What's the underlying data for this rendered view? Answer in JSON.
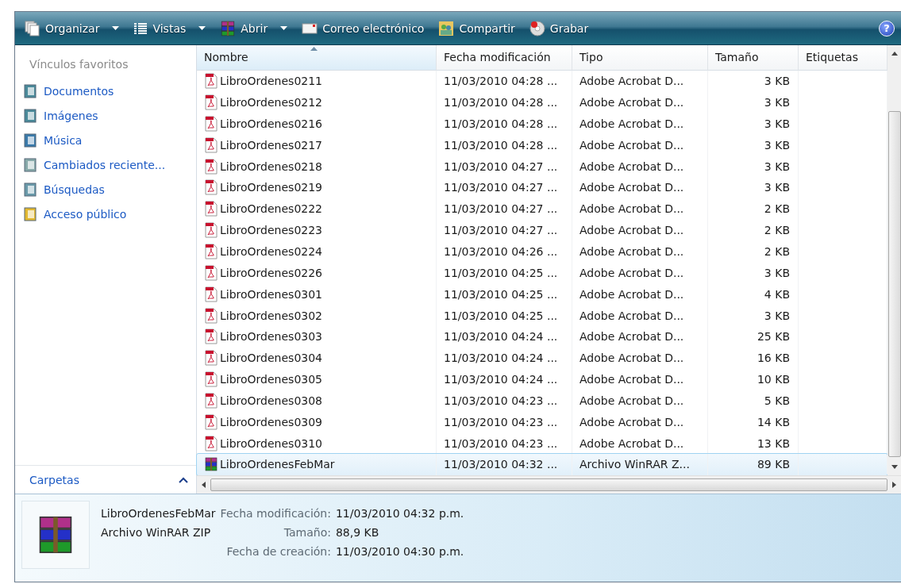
{
  "toolbar": [
    {
      "label": "Organizar",
      "dropdown": true
    },
    {
      "label": "Vistas",
      "dropdown": true
    },
    {
      "label": "Abrir",
      "dropdown": true
    },
    {
      "label": "Correo electrónico",
      "dropdown": false
    },
    {
      "label": "Compartir",
      "dropdown": false
    },
    {
      "label": "Grabar",
      "dropdown": false
    }
  ],
  "help": "?",
  "sidebar": {
    "title": "Vínculos favoritos",
    "items": [
      {
        "label": "Documentos"
      },
      {
        "label": "Imágenes"
      },
      {
        "label": "Música"
      },
      {
        "label": "Cambiados reciente..."
      },
      {
        "label": "Búsquedas"
      },
      {
        "label": "Acceso público"
      }
    ],
    "folders": "Carpetas"
  },
  "table": {
    "columns": [
      "Nombre",
      "Fecha modificación",
      "Tipo",
      "Tamaño",
      "Etiquetas"
    ],
    "rows": [
      {
        "name": "LibroOrdenes0211",
        "date": "11/03/2010 04:28 ...",
        "type": "Adobe Acrobat D...",
        "size": "3 KB",
        "kind": "pdf",
        "selected": false
      },
      {
        "name": "LibroOrdenes0212",
        "date": "11/03/2010 04:28 ...",
        "type": "Adobe Acrobat D...",
        "size": "3 KB",
        "kind": "pdf",
        "selected": false
      },
      {
        "name": "LibroOrdenes0216",
        "date": "11/03/2010 04:28 ...",
        "type": "Adobe Acrobat D...",
        "size": "3 KB",
        "kind": "pdf",
        "selected": false
      },
      {
        "name": "LibroOrdenes0217",
        "date": "11/03/2010 04:28 ...",
        "type": "Adobe Acrobat D...",
        "size": "3 KB",
        "kind": "pdf",
        "selected": false
      },
      {
        "name": "LibroOrdenes0218",
        "date": "11/03/2010 04:27 ...",
        "type": "Adobe Acrobat D...",
        "size": "3 KB",
        "kind": "pdf",
        "selected": false
      },
      {
        "name": "LibroOrdenes0219",
        "date": "11/03/2010 04:27 ...",
        "type": "Adobe Acrobat D...",
        "size": "3 KB",
        "kind": "pdf",
        "selected": false
      },
      {
        "name": "LibroOrdenes0222",
        "date": "11/03/2010 04:27 ...",
        "type": "Adobe Acrobat D...",
        "size": "2 KB",
        "kind": "pdf",
        "selected": false
      },
      {
        "name": "LibroOrdenes0223",
        "date": "11/03/2010 04:27 ...",
        "type": "Adobe Acrobat D...",
        "size": "2 KB",
        "kind": "pdf",
        "selected": false
      },
      {
        "name": "LibroOrdenes0224",
        "date": "11/03/2010 04:26 ...",
        "type": "Adobe Acrobat D...",
        "size": "2 KB",
        "kind": "pdf",
        "selected": false
      },
      {
        "name": "LibroOrdenes0226",
        "date": "11/03/2010 04:25 ...",
        "type": "Adobe Acrobat D...",
        "size": "3 KB",
        "kind": "pdf",
        "selected": false
      },
      {
        "name": "LibroOrdenes0301",
        "date": "11/03/2010 04:25 ...",
        "type": "Adobe Acrobat D...",
        "size": "4 KB",
        "kind": "pdf",
        "selected": false
      },
      {
        "name": "LibroOrdenes0302",
        "date": "11/03/2010 04:25 ...",
        "type": "Adobe Acrobat D...",
        "size": "3 KB",
        "kind": "pdf",
        "selected": false
      },
      {
        "name": "LibroOrdenes0303",
        "date": "11/03/2010 04:24 ...",
        "type": "Adobe Acrobat D...",
        "size": "25 KB",
        "kind": "pdf",
        "selected": false
      },
      {
        "name": "LibroOrdenes0304",
        "date": "11/03/2010 04:24 ...",
        "type": "Adobe Acrobat D...",
        "size": "16 KB",
        "kind": "pdf",
        "selected": false
      },
      {
        "name": "LibroOrdenes0305",
        "date": "11/03/2010 04:24 ...",
        "type": "Adobe Acrobat D...",
        "size": "10 KB",
        "kind": "pdf",
        "selected": false
      },
      {
        "name": "LibroOrdenes0308",
        "date": "11/03/2010 04:23 ...",
        "type": "Adobe Acrobat D...",
        "size": "5 KB",
        "kind": "pdf",
        "selected": false
      },
      {
        "name": "LibroOrdenes0309",
        "date": "11/03/2010 04:23 ...",
        "type": "Adobe Acrobat D...",
        "size": "14 KB",
        "kind": "pdf",
        "selected": false
      },
      {
        "name": "LibroOrdenes0310",
        "date": "11/03/2010 04:23 ...",
        "type": "Adobe Acrobat D...",
        "size": "13 KB",
        "kind": "pdf",
        "selected": false
      },
      {
        "name": "LibroOrdenesFebMar",
        "date": "11/03/2010 04:32 ...",
        "type": "Archivo WinRAR Z...",
        "size": "89 KB",
        "kind": "rar",
        "selected": true
      }
    ]
  },
  "details": {
    "name": "LibroOrdenesFebMar",
    "type": "Archivo WinRAR ZIP",
    "fields": [
      {
        "label": "Fecha modificación:",
        "value": "11/03/2010 04:32 p.m."
      },
      {
        "label": "Tamaño:",
        "value": "88,9 KB"
      },
      {
        "label": "Fecha de creación:",
        "value": "11/03/2010 04:30 p.m."
      }
    ]
  }
}
